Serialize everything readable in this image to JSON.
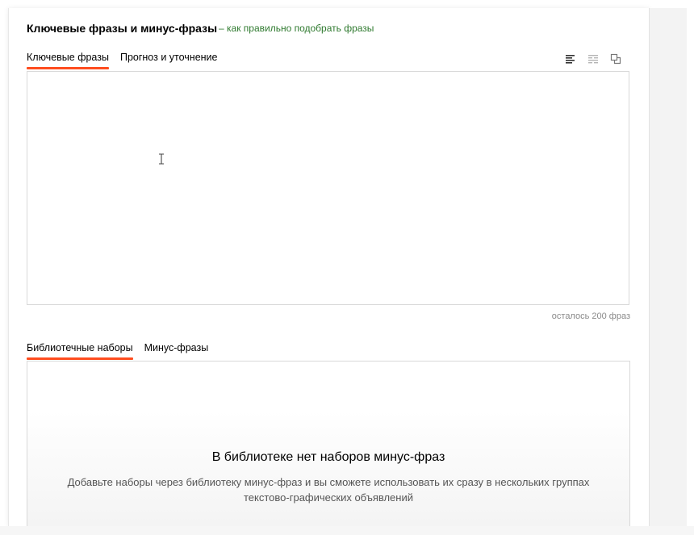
{
  "header": {
    "title": "Ключевые фразы и минус-фразы",
    "help_link": "– как правильно подобрать фразы"
  },
  "keywords_tabs": [
    {
      "label": "Ключевые фразы",
      "active": true
    },
    {
      "label": "Прогноз и уточнение",
      "active": false
    }
  ],
  "toolbar": {
    "icons": [
      "align-left-icon",
      "align-justify-icon",
      "copy-icon"
    ]
  },
  "editor": {
    "value": "",
    "counter": "осталось 200 фраз"
  },
  "minus_tabs": [
    {
      "label": "Библиотечные наборы",
      "active": true
    },
    {
      "label": "Минус-фразы",
      "active": false
    }
  ],
  "library": {
    "empty_title": "В библиотеке нет наборов минус-фраз",
    "empty_description": "Добавьте наборы через библиотеку минус-фраз и вы сможете использовать их сразу в нескольких группах текстово-графических объявлений"
  },
  "colors": {
    "accent": "#ff4d1f",
    "link": "#2f7a2f",
    "border": "#d9d9d9",
    "muted_text": "#8a8a8a"
  }
}
